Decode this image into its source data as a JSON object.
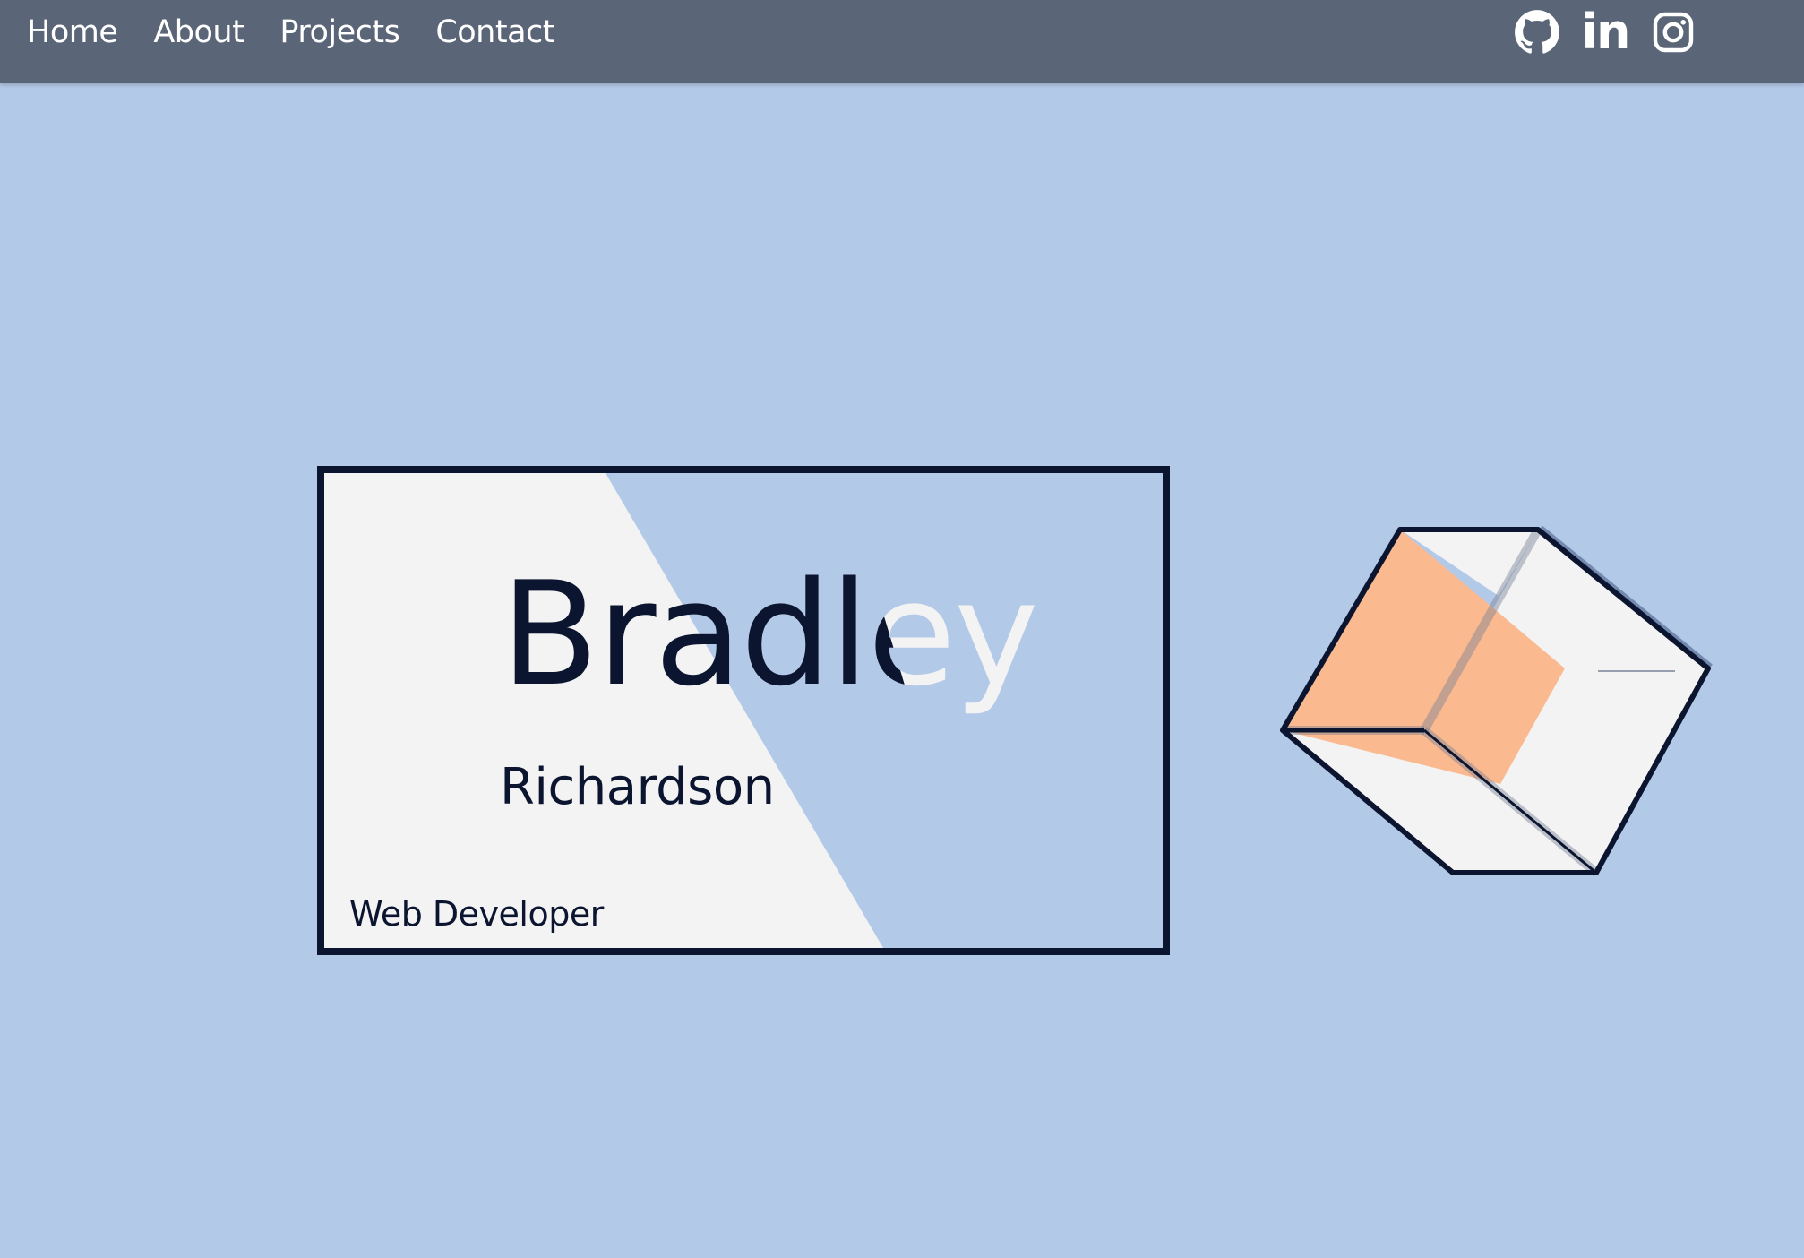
{
  "nav": {
    "links": [
      "Home",
      "About",
      "Projects",
      "Contact"
    ]
  },
  "socials": {
    "icons": [
      "github-icon",
      "linkedin-icon",
      "instagram-icon"
    ],
    "linkedin_glyph": "in"
  },
  "card": {
    "first_name": "Bradley",
    "last_name": "Richardson",
    "job_title": "Web Developer"
  },
  "colors": {
    "background": "#b3c9e8",
    "navbar": "#5a6577",
    "ink": "#0c1530",
    "card_light": "#f3f3f4",
    "accent": "#fbb98f"
  }
}
